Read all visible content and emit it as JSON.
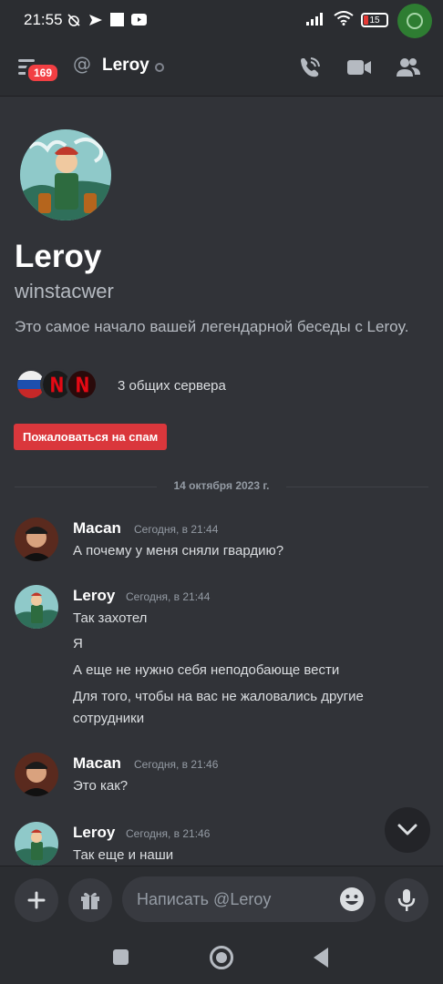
{
  "status_bar": {
    "time": "21:55",
    "battery": "15"
  },
  "header": {
    "badge_count": "169",
    "title": "Leroy"
  },
  "profile": {
    "display_name": "Leroy",
    "username": "winstacwer",
    "intro_text": "Это самое начало вашей легендарной беседы с Leroy.",
    "mutual_servers_text": "3 общих сервера",
    "spam_button": "Пожаловаться на спам"
  },
  "date_divider": "14 октября 2023 г.",
  "messages": [
    {
      "author": "Macan",
      "timestamp": "Сегодня, в 21:44",
      "lines": [
        "А почему у меня сняли гвардию?"
      ]
    },
    {
      "author": "Leroy",
      "timestamp": "Сегодня, в 21:44",
      "lines": [
        "Так захотел",
        "Я",
        "А еще не нужно себя неподобающе вести",
        "Для того, чтобы на вас не жаловались другие",
        "сотрудники"
      ]
    },
    {
      "author": "Macan",
      "timestamp": "Сегодня, в 21:46",
      "lines": [
        "Это как?"
      ]
    },
    {
      "author": "Leroy",
      "timestamp": "Сегодня, в 21:46",
      "lines": [
        "Так еще и наши"
      ]
    }
  ],
  "composer": {
    "placeholder": "Написать @Leroy"
  },
  "colors": {
    "background": "#313338",
    "accent_red": "#da373c",
    "badge_red": "#f23f43"
  },
  "icons": [
    "menu-icon",
    "at-icon",
    "call-icon",
    "video-icon",
    "members-icon",
    "plus-icon",
    "gift-icon",
    "emoji-icon",
    "mic-icon",
    "chevron-down-icon"
  ]
}
